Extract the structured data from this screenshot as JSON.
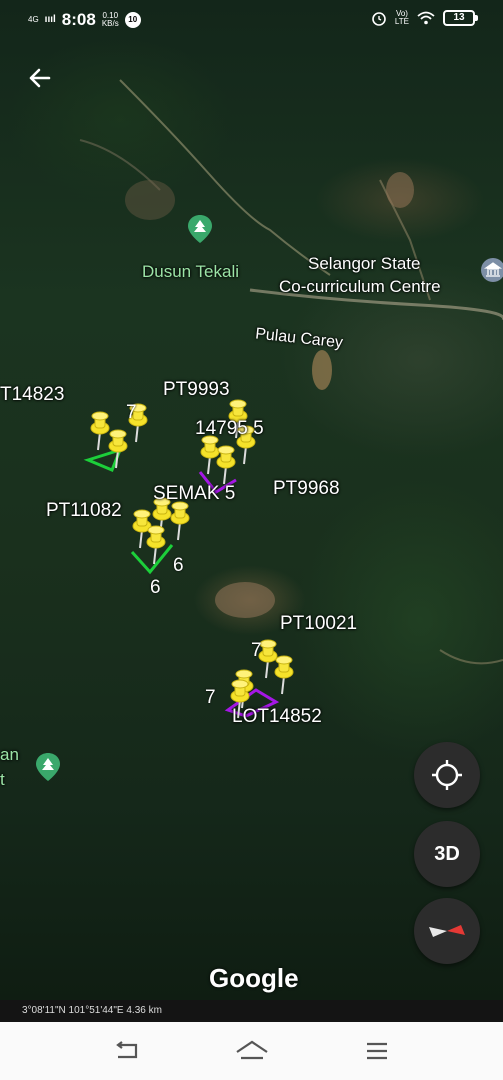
{
  "status": {
    "network": "4G",
    "signal": "ıııl",
    "time": "8:08",
    "speed_value": "0.10",
    "speed_unit": "KB/s",
    "notif_badge": "10",
    "volte": "Vo)\nLTE",
    "battery": "13"
  },
  "places": {
    "dusun": "Dusun Tekali",
    "selangor_1": "Selangor State",
    "selangor_2": "Co-curriculum Centre",
    "pulau": "Pulau Carey",
    "left_partial_1": "an",
    "left_partial_2": "t"
  },
  "parcels": {
    "pt14823": "T14823",
    "n7a": "7",
    "pt9993": "PT9993",
    "n14795": "14795 5",
    "semak": "SEMAK 5",
    "pt9968": "PT9968",
    "pt11082": "PT11082",
    "n6a": "6",
    "n6b": "6",
    "pt10021": "PT10021",
    "n7b": "7",
    "n7c": "7",
    "lot14852": "LOT14852"
  },
  "controls": {
    "back_icon": "arrow-left-icon",
    "three_d": "3D",
    "compass_icon": "compass-icon",
    "locate_icon": "my-location-icon"
  },
  "attribution": "Google",
  "coord_readout": "3°08'11\"N 101°51'44\"E 4.36 km",
  "colors": {
    "pin": "#f5e22a",
    "green_outline": "#1ccf3a",
    "purple_outline": "#a517e6",
    "poi": "#3aa86b"
  }
}
